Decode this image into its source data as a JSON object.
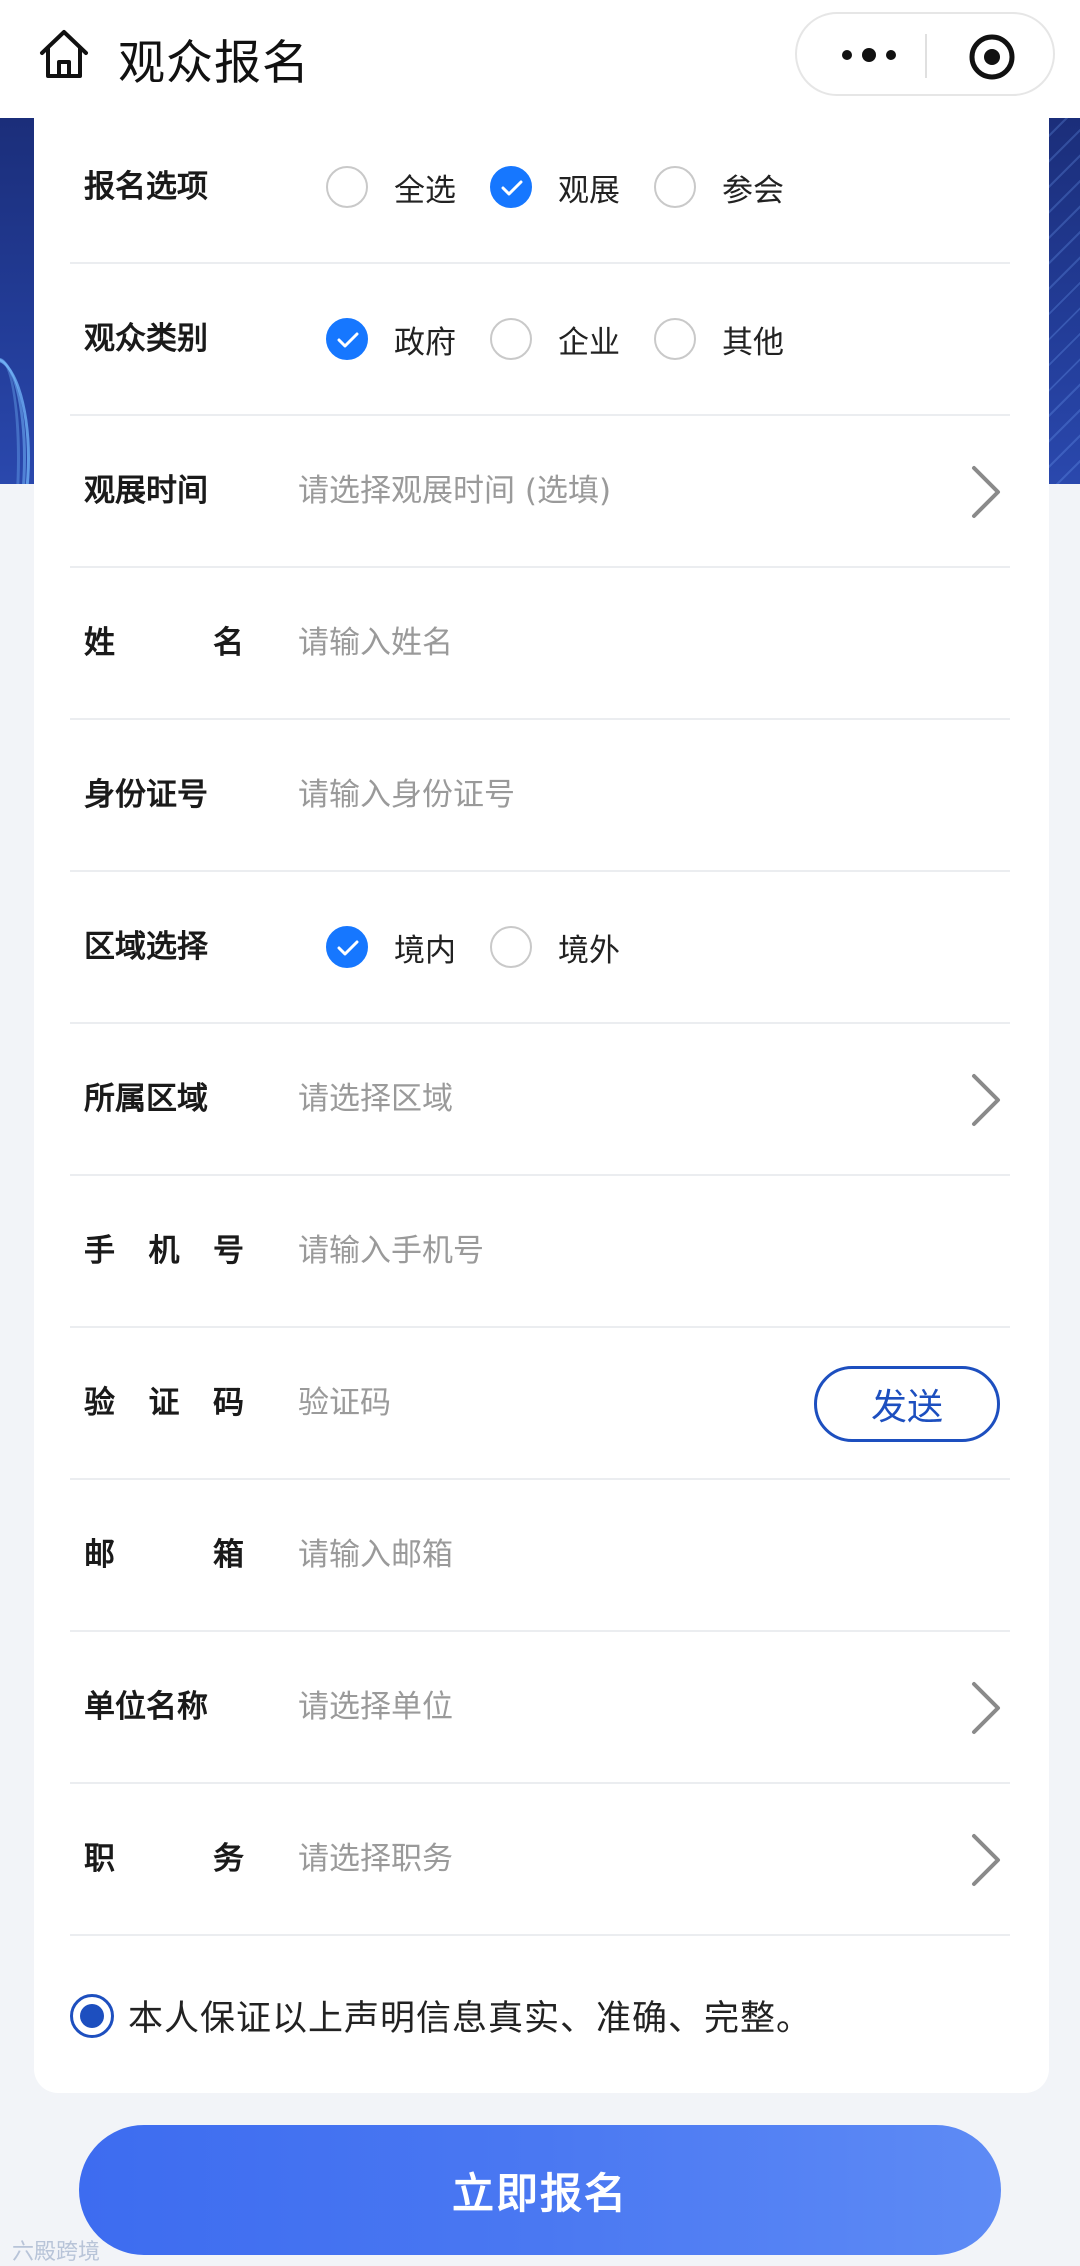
{
  "header": {
    "title": "观众报名"
  },
  "form": {
    "reg_option": {
      "label": "报名选项",
      "options": [
        "全选",
        "观展",
        "参会"
      ],
      "selected": "观展"
    },
    "audience_type": {
      "label": "观众类别",
      "options": [
        "政府",
        "企业",
        "其他"
      ],
      "selected": "政府"
    },
    "visit_time": {
      "label": "观展时间",
      "placeholder": "请选择观展时间 (选填)"
    },
    "name": {
      "label_a": "姓",
      "label_b": "名",
      "placeholder": "请输入姓名"
    },
    "id_number": {
      "label": "身份证号",
      "placeholder": "请输入身份证号"
    },
    "region_choice": {
      "label": "区域选择",
      "options": [
        "境内",
        "境外"
      ],
      "selected": "境内"
    },
    "region": {
      "label": "所属区域",
      "placeholder": "请选择区域"
    },
    "phone": {
      "label_a": "手",
      "label_b": "机",
      "label_c": "号",
      "placeholder": "请输入手机号"
    },
    "code": {
      "label_a": "验",
      "label_b": "证",
      "label_c": "码",
      "placeholder": "验证码",
      "send_label": "发送"
    },
    "email": {
      "label_a": "邮",
      "label_b": "箱",
      "placeholder": "请输入邮箱"
    },
    "company": {
      "label": "单位名称",
      "placeholder": "请选择单位"
    },
    "position": {
      "label_a": "职",
      "label_b": "务",
      "placeholder": "请选择职务"
    }
  },
  "agreement": {
    "text": "本人保证以上声明信息真实、准确、完整。",
    "checked": true
  },
  "submit_label": "立即报名",
  "watermark": "六殿跨境",
  "colors": {
    "accent": "#1677ff",
    "brand_dark": "#1d4fbf",
    "banner": "#233d99"
  }
}
